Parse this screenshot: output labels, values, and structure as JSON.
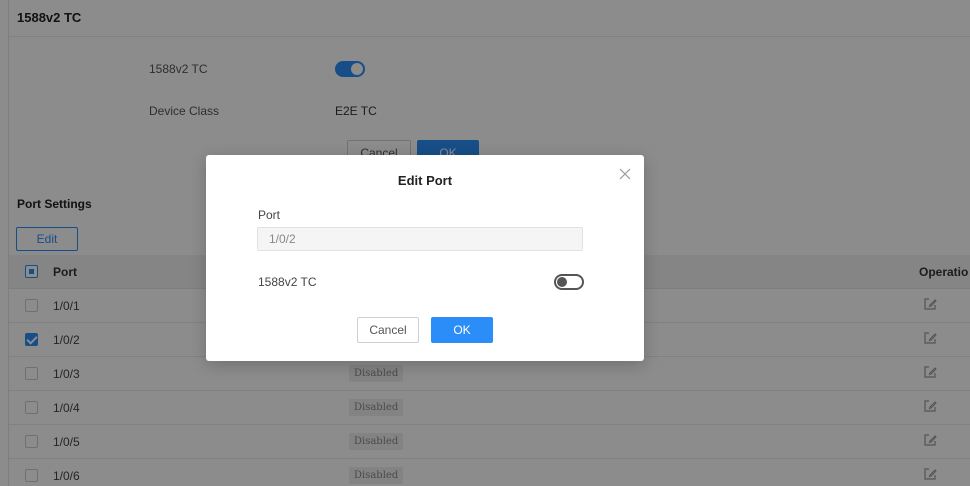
{
  "section": {
    "title": "1588v2 TC",
    "tc_label": "1588v2 TC",
    "tc_enabled": true,
    "device_class_label": "Device Class",
    "device_class_value": "E2E TC",
    "cancel_label": "Cancel",
    "ok_label": "OK"
  },
  "port_settings": {
    "title": "Port Settings",
    "edit_label": "Edit"
  },
  "table": {
    "columns": {
      "port": "Port",
      "operation": "Operatio"
    },
    "rows": [
      {
        "port": "1/0/1",
        "status": "",
        "checked": false
      },
      {
        "port": "1/0/2",
        "status": "",
        "checked": true
      },
      {
        "port": "1/0/3",
        "status": "Disabled",
        "checked": false
      },
      {
        "port": "1/0/4",
        "status": "Disabled",
        "checked": false
      },
      {
        "port": "1/0/5",
        "status": "Disabled",
        "checked": false
      },
      {
        "port": "1/0/6",
        "status": "Disabled",
        "checked": false
      }
    ]
  },
  "modal": {
    "title": "Edit Port",
    "port_label": "Port",
    "port_value": "1/0/2",
    "tc_label": "1588v2 TC",
    "tc_enabled": false,
    "cancel_label": "Cancel",
    "ok_label": "OK"
  },
  "icons": {
    "edit": "edit-icon",
    "close": "close-icon"
  },
  "colors": {
    "accent": "#2b8ef8",
    "overlay": "rgba(0,0,0,0.45)"
  }
}
